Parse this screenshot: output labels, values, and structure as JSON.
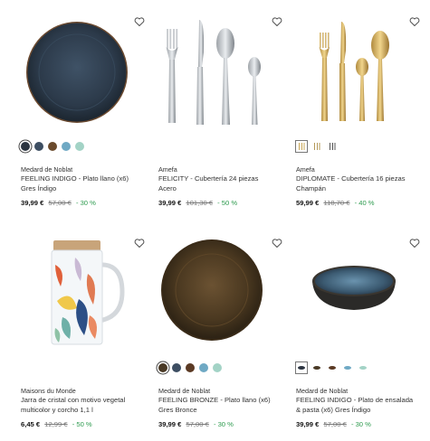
{
  "products": [
    {
      "brand": "Medard de Noblat",
      "title": "FEELING INDIGO - Plato llano (x6) Gres Índigo",
      "price": "39,99 €",
      "old_price": "57,00 €",
      "discount": "- 30 %",
      "swatch_colors": [
        "#2b3440",
        "#3d4e62",
        "#6a4a2c",
        "#6fa9c4",
        "#a3d3c6"
      ]
    },
    {
      "brand": "Amefa",
      "title": "FELICITY - Cubertería 24 piezas Acero",
      "price": "39,99 €",
      "old_price": "101,30 €",
      "discount": "- 50 %"
    },
    {
      "brand": "Amefa",
      "title": "DIPLOMATE - Cubertería 16 piezas Champán",
      "price": "59,99 €",
      "old_price": "118,70 €",
      "discount": "- 40 %"
    },
    {
      "brand": "Maisons du Monde",
      "title": "Jarra de cristal con motivo vegetal multicolor y corcho 1,1 l",
      "price": "6,45 €",
      "old_price": "12,99 €",
      "discount": "- 50 %"
    },
    {
      "brand": "Medard de Noblat",
      "title": "FEELING BRONZE - Plato llano (x6) Gres Bronce",
      "price": "39,99 €",
      "old_price": "57,00 €",
      "discount": "- 30 %",
      "swatch_colors": [
        "#4a3a26",
        "#3d4e62",
        "#5b3a24",
        "#6fa9c4",
        "#a3d3c6"
      ]
    },
    {
      "brand": "Medard de Noblat",
      "title": "FEELING INDIGO - Plato de ensalada & pasta (x6) Gres Índigo",
      "price": "39,99 €",
      "old_price": "57,00 €",
      "discount": "- 30 %"
    }
  ],
  "colors": {
    "discount": "#2e9b4f",
    "price": "#111111",
    "old_price": "#777777"
  },
  "icons": {
    "wishlist": "heart-outline-icon"
  }
}
